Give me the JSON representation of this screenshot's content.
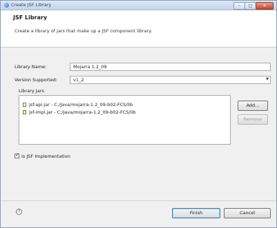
{
  "window": {
    "title": "Create JSF Library"
  },
  "header": {
    "title": "JSF Library",
    "description": "Create a library of jars that make up a JSF component library."
  },
  "form": {
    "library_name_label": "Library Name:",
    "library_name_value": "Mojarra 1.2_09",
    "version_label": "Version Supported:",
    "version_value": "v1_2",
    "jars_label": "Library Jars",
    "jars": [
      "jsf-api.jar - C:/Java/mojarra-1.2_09-b02-FCS/lib",
      "jsf-impl.jar - C:/Java/mojarra-1.2_09-b02-FCS/lib"
    ],
    "add_label": "Add...",
    "remove_label": "Remove",
    "impl_checkbox_label": "Is JSF Implementation",
    "impl_checked": true
  },
  "footer": {
    "help_symbol": "?",
    "finish_label": "Finish",
    "cancel_label": "Cancel"
  }
}
